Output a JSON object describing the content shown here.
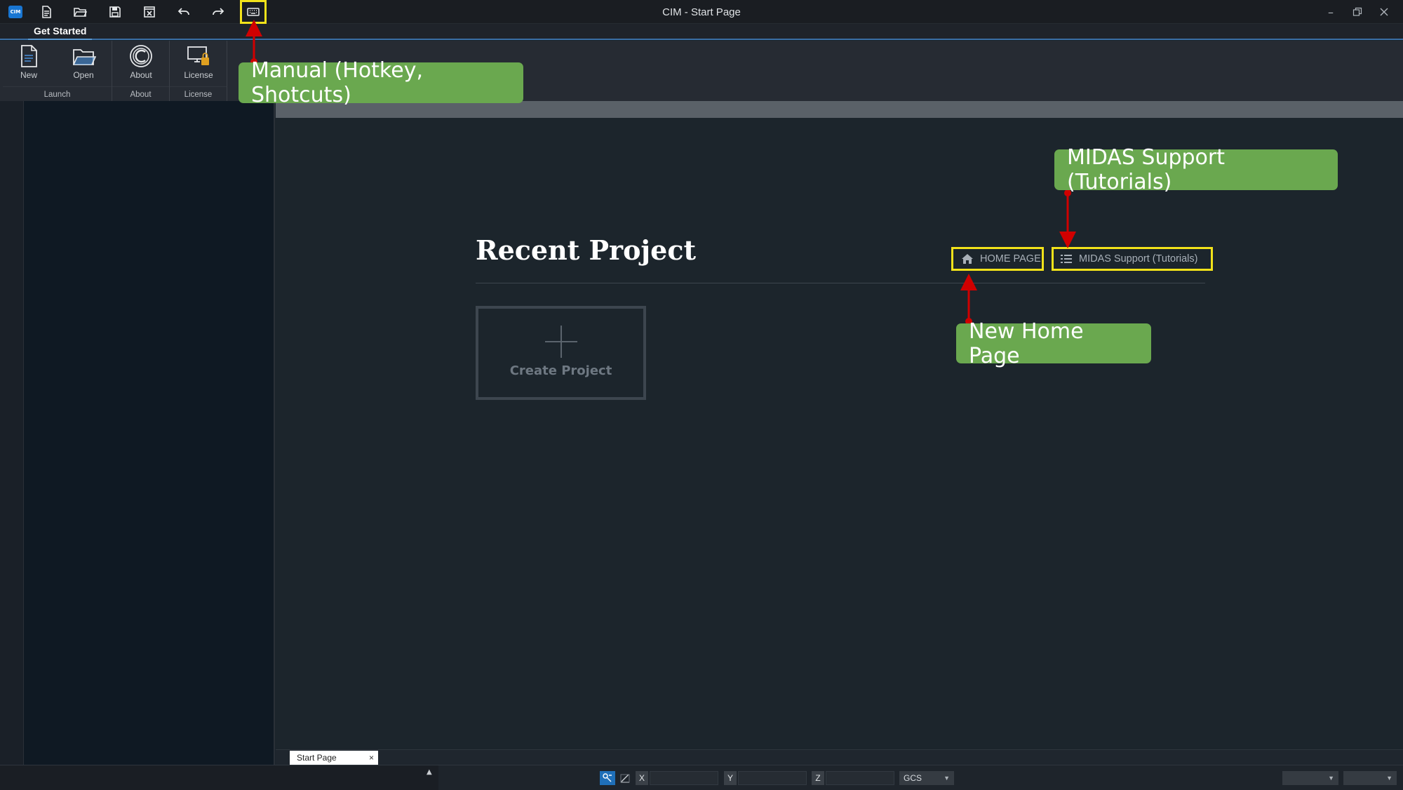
{
  "window": {
    "title": "CIM - Start Page",
    "logo_text": "CIM"
  },
  "quick_access": [
    {
      "icon": "new-file-icon"
    },
    {
      "icon": "open-folder-icon"
    },
    {
      "icon": "save-icon"
    },
    {
      "icon": "close-file-icon"
    },
    {
      "icon": "undo-icon"
    },
    {
      "icon": "redo-icon"
    },
    {
      "icon": "keyboard-icon"
    }
  ],
  "ribbon": {
    "tab": "Get Started",
    "groups": [
      {
        "label": "Launch",
        "buttons": [
          {
            "label": "New",
            "icon": "new-document-icon"
          },
          {
            "label": "Open",
            "icon": "open-folder-icon"
          }
        ]
      },
      {
        "label": "About",
        "buttons": [
          {
            "label": "About",
            "icon": "about-icon"
          }
        ]
      },
      {
        "label": "License",
        "buttons": [
          {
            "label": "License",
            "icon": "license-icon"
          }
        ]
      }
    ]
  },
  "start_page": {
    "recent_title": "Recent Project",
    "create_label": "Create Project",
    "home_link": "HOME PAGE",
    "support_link": "MIDAS Support (Tutorials)"
  },
  "doc_tab": {
    "label": "Start Page",
    "close": "×"
  },
  "statusbar": {
    "caret": "▲",
    "x_label": "X",
    "y_label": "Y",
    "z_label": "Z",
    "coord_system": "GCS"
  },
  "annotations": {
    "manual": "Manual (Hotkey, Shotcuts)",
    "support": "MIDAS Support (Tutorials)",
    "home": "New Home Page"
  },
  "colors": {
    "callout": "#6aa84f",
    "highlight": "#f2e21a",
    "arrow": "#d00000",
    "accent": "#1976d2"
  }
}
